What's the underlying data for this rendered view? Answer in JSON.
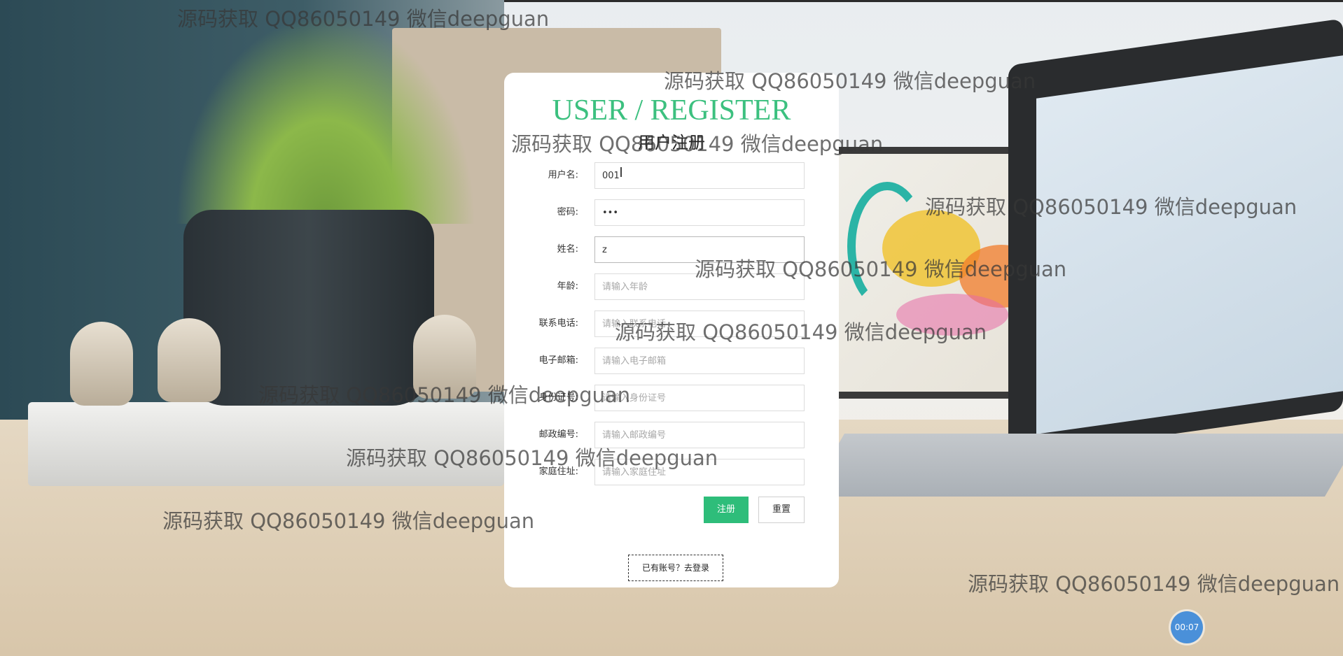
{
  "register": {
    "title_en": "USER / REGISTER",
    "title_cn": "用户注册",
    "fields": [
      {
        "label": "用户名:",
        "value": "001",
        "placeholder": ""
      },
      {
        "label": "密码:",
        "value": "•••",
        "placeholder": ""
      },
      {
        "label": "姓名:",
        "value": "z",
        "placeholder": ""
      },
      {
        "label": "年龄:",
        "value": "",
        "placeholder": "请输入年龄"
      },
      {
        "label": "联系电话:",
        "value": "",
        "placeholder": "请输入联系电话"
      },
      {
        "label": "电子邮箱:",
        "value": "",
        "placeholder": "请输入电子邮箱"
      },
      {
        "label": "身份证号:",
        "value": "",
        "placeholder": "请输入身份证号"
      },
      {
        "label": "邮政编号:",
        "value": "",
        "placeholder": "请输入邮政编号"
      },
      {
        "label": "家庭住址:",
        "value": "",
        "placeholder": "请输入家庭住址"
      }
    ],
    "register_button": "注册",
    "reset_button": "重置",
    "login_link": "已有账号？去登录"
  },
  "watermark": {
    "text": "源码获取 QQ86050149 微信deepguan"
  },
  "timer": {
    "label": "00:07"
  },
  "colors": {
    "accent": "#3cc07f",
    "button": "#2ebd7a",
    "timer": "#4a90d9"
  }
}
